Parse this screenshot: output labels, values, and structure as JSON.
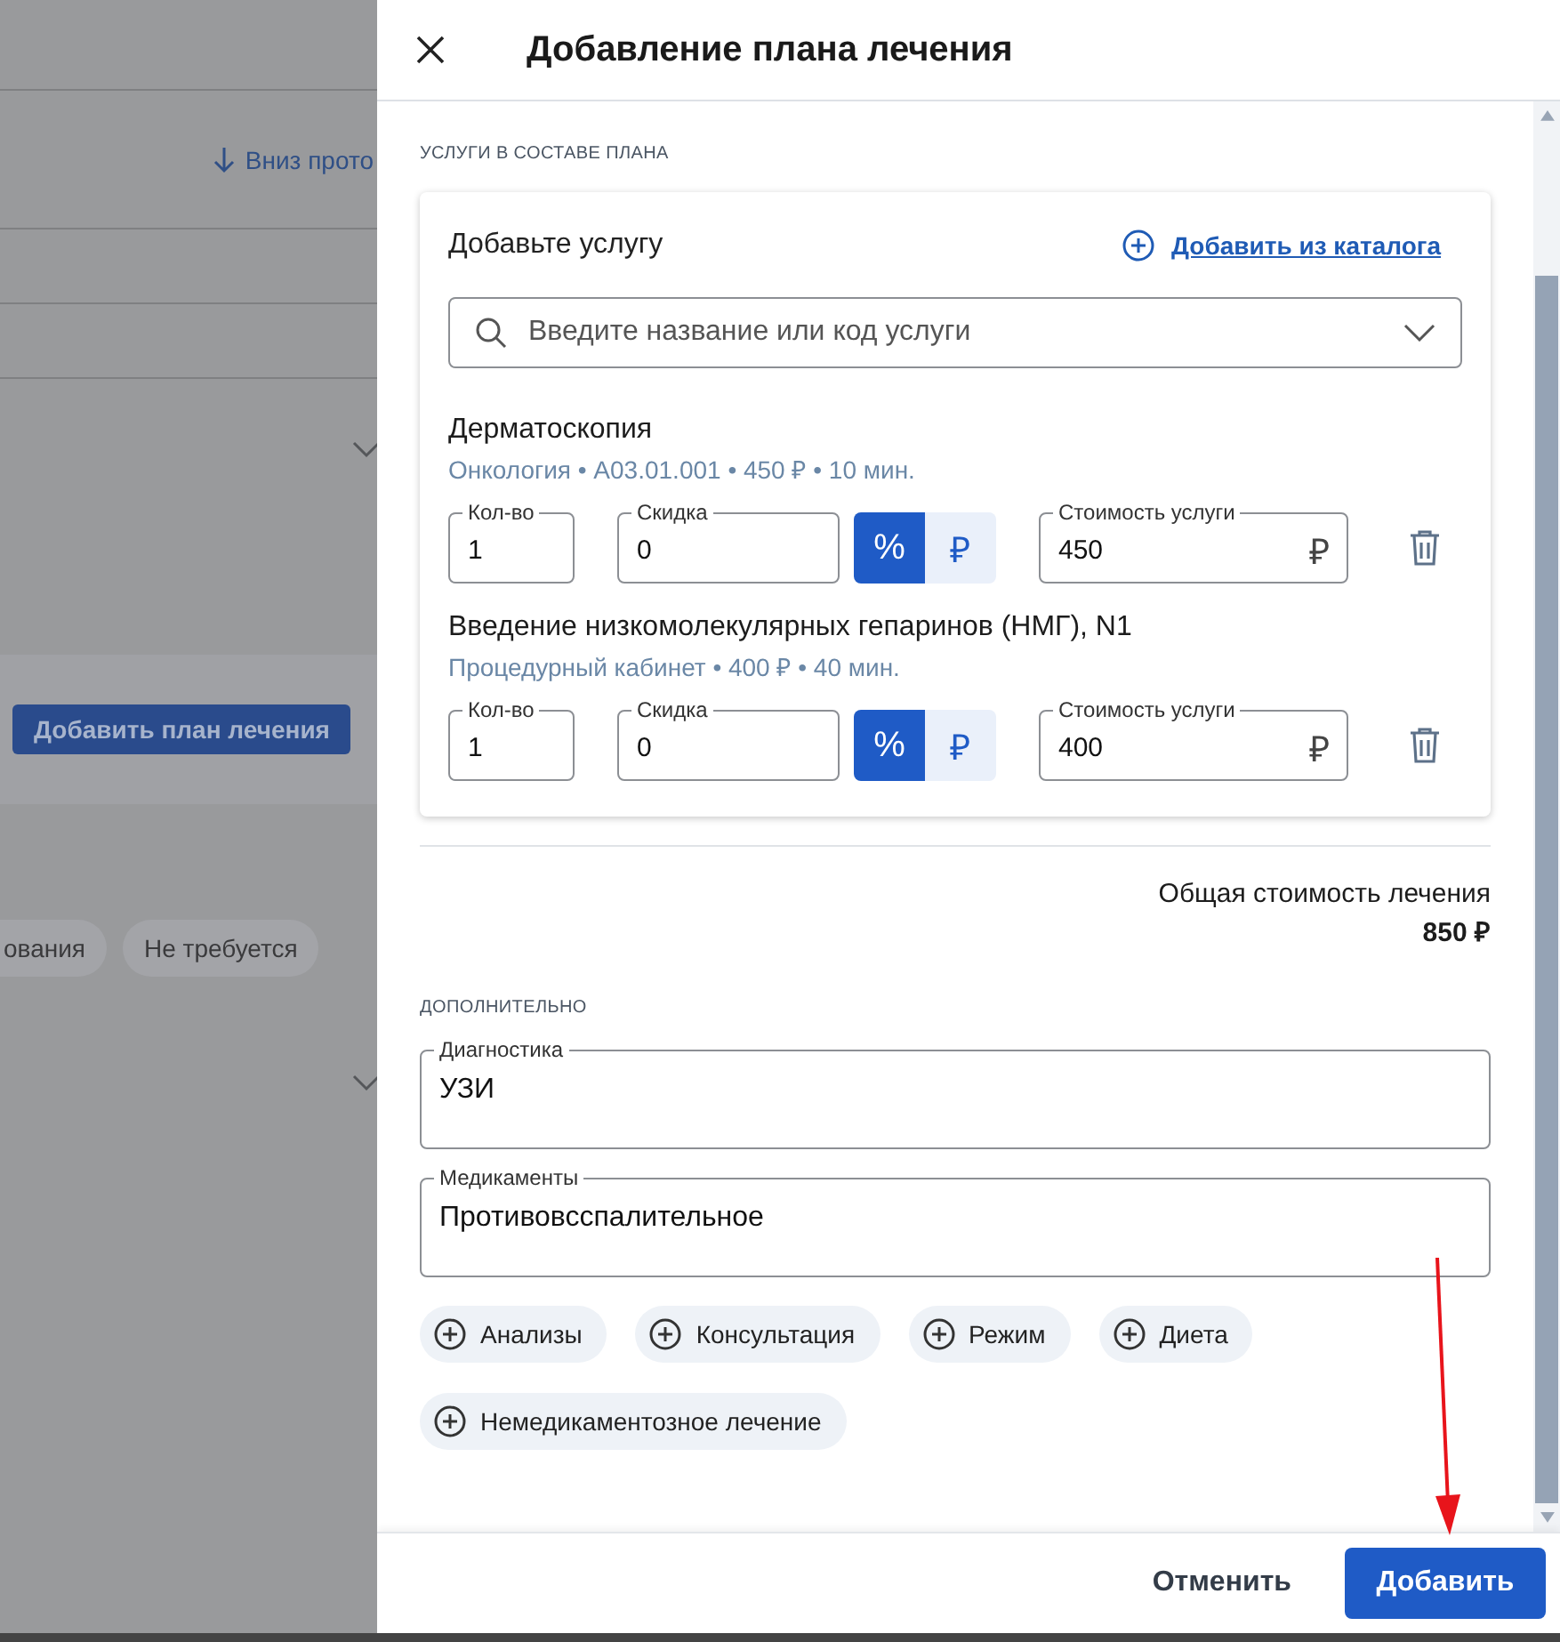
{
  "background_page": {
    "link": "Вниз прото",
    "button": "Добавить план лечения",
    "chips": [
      "ования",
      "Не требуется"
    ]
  },
  "drawer": {
    "title": "Добавление плана лечения",
    "services_section": {
      "heading": "УСЛУГИ В СОСТАВЕ ПЛАНА",
      "add_label": "Добавьте услугу",
      "catalog_link": "Добавить из каталога",
      "search": {
        "placeholder": "Введите название или код услуги"
      },
      "services": [
        {
          "name": "Дерматоскопия",
          "meta": "Онкология • A03.01.001 • 450 ₽ • 10 мин.",
          "quantity": {
            "label": "Кол-во",
            "value": "1"
          },
          "discount": {
            "label": "Скидка",
            "value": "0"
          },
          "discount_units": [
            {
              "symbol": "%",
              "selected": true
            },
            {
              "symbol": "₽",
              "selected": false
            }
          ],
          "cost": {
            "label": "Стоимость услуги",
            "value": "450",
            "currency": "₽"
          }
        },
        {
          "name": "Введение низкомолекулярных гепаринов (НМГ), N1",
          "meta": "Процедурный кабинет • 400 ₽ • 40 мин.",
          "quantity": {
            "label": "Кол-во",
            "value": "1"
          },
          "discount": {
            "label": "Скидка",
            "value": "0"
          },
          "discount_units": [
            {
              "symbol": "%",
              "selected": true
            },
            {
              "symbol": "₽",
              "selected": false
            }
          ],
          "cost": {
            "label": "Стоимость услуги",
            "value": "400",
            "currency": "₽"
          }
        }
      ]
    },
    "total": {
      "label": "Общая стоимость лечения",
      "value": "850 ₽"
    },
    "extra_section": {
      "heading": "ДОПОЛНИТЕЛЬНО",
      "fields": [
        {
          "label": "Диагностика",
          "value": "УЗИ"
        },
        {
          "label": "Медикаменты",
          "value": "Противовсспалительное"
        }
      ],
      "add_chips": [
        "Анализы",
        "Консультация",
        "Режим",
        "Диета",
        "Немедикаментозное лечение"
      ]
    },
    "footer": {
      "cancel": "Отменить",
      "submit": "Добавить"
    }
  }
}
